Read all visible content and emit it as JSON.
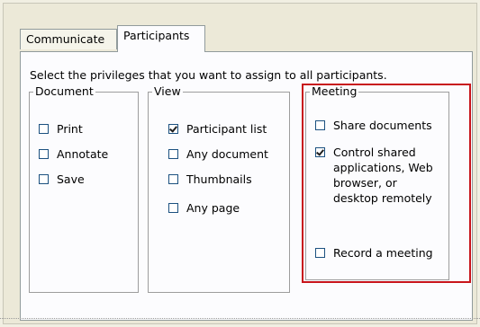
{
  "tabs": [
    {
      "label": "Communicate",
      "selected": false
    },
    {
      "label": "Participants",
      "selected": true
    }
  ],
  "instructions": "Select the privileges that you want to assign to all participants.",
  "groups": {
    "document": {
      "title": "Document",
      "items": [
        {
          "label": "Print",
          "checked": false
        },
        {
          "label": "Annotate",
          "checked": false
        },
        {
          "label": "Save",
          "checked": false
        }
      ]
    },
    "view": {
      "title": "View",
      "items": [
        {
          "label": "Participant list",
          "checked": true
        },
        {
          "label": "Any document",
          "checked": false
        },
        {
          "label": "Thumbnails",
          "checked": false
        },
        {
          "label": "Any page",
          "checked": false
        }
      ]
    },
    "meeting": {
      "title": "Meeting",
      "items": [
        {
          "label": "Share documents",
          "checked": false
        },
        {
          "label": "Control shared applications, Web browser, or desktop remotely",
          "checked": true
        },
        {
          "label": "Record a meeting",
          "checked": false
        }
      ]
    }
  },
  "highlight_color": "#c8151b"
}
